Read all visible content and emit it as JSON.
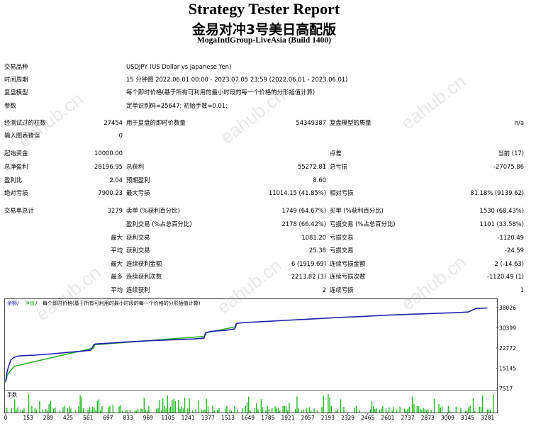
{
  "header": {
    "title": "Strategy Tester Report",
    "subtitle": "金易对冲3号美日高配版",
    "server": "MogaIntlGroup-LiveAsia (Build 1400)"
  },
  "info": {
    "symbol_label": "交易品种",
    "symbol_value": "USDJPY (US Dollar vs Japanese Yen)",
    "period_label": "时间周期",
    "period_value": "15 分钟图 2022.06.01 00:00 - 2023.07.05 23:59 (2022.06.01 - 2023.06.01)",
    "model_label": "复盘模型",
    "model_value": "每个即时价格(基于所有可利用的最小时段的每一个价格的分形插值计算)",
    "params_label": "参数",
    "params_value": "定单识别码=25647; 初始手数=0.01;"
  },
  "stats1": {
    "bars_label": "经测试过的柱数",
    "bars_value": "27454",
    "ticks_label": "用于复盘的即时价数量",
    "ticks_value": "54349387",
    "quality_label": "复盘模型的质量",
    "quality_value": "n/a",
    "errors_label": "输入图表错误",
    "errors_value": "0"
  },
  "stats2": {
    "deposit_label": "起始资金",
    "deposit_value": "10000.00",
    "spread_label": "点差",
    "spread_value": "当前 (17)",
    "netprofit_label": "总净盈利",
    "netprofit_value": "28196.95",
    "grossprofit_label": "总获利",
    "grossprofit_value": "55272.81",
    "grossloss_label": "总亏损",
    "grossloss_value": "-27075.86",
    "pf_label": "盈利比",
    "pf_value": "2.04",
    "expected_label": "预期盈利",
    "expected_value": "8.60",
    "absdd_label": "绝对亏损",
    "absdd_value": "7900.23",
    "maxdd_label": "最大亏损",
    "maxdd_value": "11014.15 (41.85%)",
    "reldd_label": "相对亏损",
    "reldd_value": "81.18% (9139.62)"
  },
  "stats3": {
    "trades_label": "交易单总计",
    "trades_value": "3279",
    "short_label": "卖单 (%获利百分比)",
    "short_value": "1749 (64.67%)",
    "long_label": "买单 (%获利百分比)",
    "long_value": "1530 (68.43%)",
    "profit_trades_label": "盈利交易 (%占总百分比)",
    "profit_trades_value": "2178 (66.42%)",
    "loss_trades_label": "亏损交易 (%占总百分比)",
    "loss_trades_value": "1101 (33.58%)",
    "max_label": "最大",
    "max_profit_label": "获利交易",
    "max_profit_value": "1081.20",
    "max_loss_label": "亏损交易",
    "max_loss_value": "-1120.49",
    "avg_label": "平均",
    "avg_profit_label": "获利交易",
    "avg_profit_value": "25.38",
    "avg_loss_label": "亏损交易",
    "avg_loss_value": "-24.59",
    "max2_label": "最大",
    "cons_wins_label": "连续获利金额",
    "cons_wins_value": "6 (1919.69)",
    "cons_losses_label": "连续亏损金额",
    "cons_losses_value": "2 (-14.63)",
    "most_label": "最多",
    "cons_profit_label": "连续获利次数",
    "cons_profit_value": "2213.82 (3)",
    "cons_loss_label": "连续亏损次数",
    "cons_loss_value": "-1120.49 (1)",
    "avg2_label": "平均",
    "avg_cons_wins_label": "连续获利",
    "avg_cons_wins_value": "2",
    "avg_cons_losses_label": "连续亏损",
    "avg_cons_losses_value": "1"
  },
  "watermark": "eahub.cn",
  "chart_data": {
    "type": "line",
    "legend_balance": "余额",
    "legend_sep1": " / ",
    "legend_equity": "净值",
    "legend_sep2": " / ",
    "legend_model": "每个即时价格(基于所有可利用的最小时段的每一个价格的分形插值计算)",
    "lots_label": "手数",
    "x_ticks": [
      "0",
      "153",
      "289",
      "425",
      "561",
      "697",
      "833",
      "969",
      "1105",
      "1241",
      "1377",
      "1513",
      "1649",
      "1785",
      "1921",
      "2057",
      "2193",
      "2329",
      "2465",
      "2601",
      "2737",
      "2873",
      "3009",
      "3145",
      "3281"
    ],
    "y_ticks": [
      "38026",
      "30399",
      "22772",
      "15145",
      "7517"
    ],
    "x_range": [
      0,
      3340
    ],
    "y_range": [
      7517,
      38026
    ],
    "colors": {
      "balance": "#1f1fa8",
      "equity": "#2bb12b",
      "lots": "#22bb22"
    },
    "series": [
      {
        "name": "余额",
        "x": [
          0,
          8,
          20,
          35,
          55,
          80,
          120,
          200,
          300,
          420,
          520,
          580,
          600,
          610,
          700,
          800,
          900,
          1000,
          1100,
          1200,
          1280,
          1350,
          1360,
          1400,
          1500,
          1560,
          1570,
          1620,
          1700,
          1800,
          1900,
          2000,
          2100,
          2200,
          2300,
          2400,
          2500,
          2600,
          2700,
          2800,
          2900,
          3000,
          3100,
          3150,
          3200,
          3280
        ],
        "y": [
          10000,
          13500,
          15800,
          18200,
          19200,
          19700,
          19900,
          20100,
          20500,
          21100,
          21600,
          22000,
          24000,
          24300,
          24600,
          25000,
          25300,
          25600,
          25800,
          26000,
          26200,
          26500,
          28500,
          29100,
          29500,
          30000,
          32000,
          32400,
          32600,
          32900,
          33200,
          33500,
          33800,
          34100,
          34400,
          34600,
          34900,
          35200,
          35400,
          35600,
          35800,
          36000,
          36200,
          36400,
          37700,
          37900
        ]
      },
      {
        "name": "净值",
        "x": [
          0,
          10,
          30,
          60,
          600,
          605,
          1355,
          1365,
          1565,
          1575
        ],
        "y": [
          9800,
          12500,
          14000,
          15900,
          22800,
          24000,
          27200,
          28500,
          30800,
          32000
        ]
      }
    ]
  }
}
